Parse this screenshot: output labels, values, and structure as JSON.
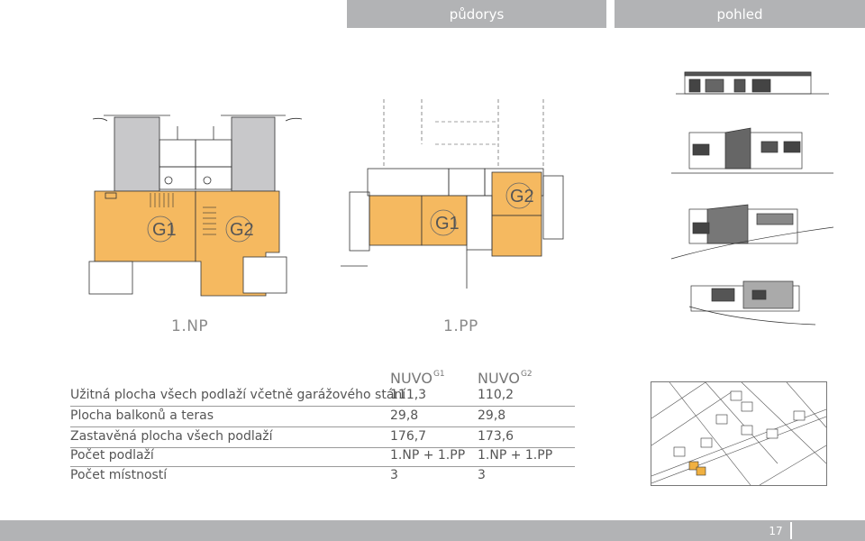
{
  "tabs": {
    "left": "půdorys",
    "right": "pohled"
  },
  "floors": {
    "np_label": "1.NP",
    "pp_label": "1.PP"
  },
  "room_tags": {
    "g1": "G1",
    "g2": "G2"
  },
  "colors": {
    "room_fill": "#f5b960",
    "garage_fill": "#c8c8ca",
    "tab_gray": "#b2b3b5",
    "highlight": "#f0b040"
  },
  "table": {
    "col1_head": "NUVO",
    "col1_sup": "G1",
    "col2_head": "NUVO",
    "col2_sup": "G2",
    "rows": [
      {
        "label": "Užitná plocha všech podlaží včetně garážového stání",
        "v1": "111,3",
        "v2": "110,2"
      },
      {
        "label": "Plocha balkonů a teras",
        "v1": "29,8",
        "v2": "29,8"
      },
      {
        "label": "Zastavěná plocha všech podlaží",
        "v1": "176,7",
        "v2": "173,6"
      },
      {
        "label": "Počet podlaží",
        "v1": "1.NP + 1.PP",
        "v2": "1.NP + 1.PP"
      },
      {
        "label": "Počet místností",
        "v1": "3",
        "v2": "3"
      }
    ]
  },
  "page_number": "17"
}
